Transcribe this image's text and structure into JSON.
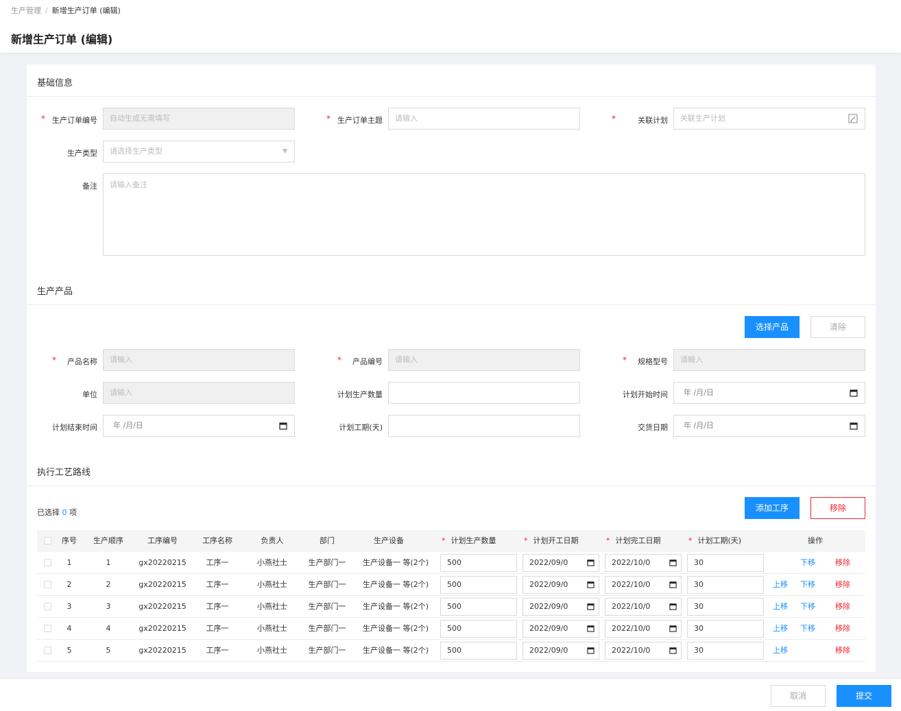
{
  "breadcrumb": {
    "parent": "生产管理",
    "separator": "/",
    "current": "新增生产订单 (编辑)"
  },
  "page_title": "新增生产订单 (编辑)",
  "basic": {
    "title": "基础信息",
    "order_no": {
      "label": "生产订单编号",
      "placeholder": "自动生成无需填写"
    },
    "order_subject": {
      "label": "生产订单主题",
      "placeholder": "请输入"
    },
    "related_plan": {
      "label": "关联计划",
      "placeholder": "关联生产计划",
      "icon": "edit-icon"
    },
    "prod_type": {
      "label": "生产类型",
      "placeholder": "请选择生产类型"
    },
    "remark": {
      "label": "备注",
      "placeholder": "请输入备注"
    }
  },
  "product": {
    "title": "生产产品",
    "select_btn": "选择产品",
    "clear_btn": "清除",
    "name": {
      "label": "产品名称",
      "placeholder": "请输入"
    },
    "code": {
      "label": "产品编号",
      "placeholder": "请输入"
    },
    "spec": {
      "label": "规格型号",
      "placeholder": "请输入"
    },
    "unit": {
      "label": "单位",
      "placeholder": "请输入"
    },
    "plan_qty": {
      "label": "计划生产数量",
      "value": ""
    },
    "plan_start": {
      "label": "计划开始时间",
      "value": "年 /月/日"
    },
    "plan_end": {
      "label": "计划结束时间",
      "value": "年 /月/日"
    },
    "plan_days": {
      "label": "计划工期(天)",
      "value": ""
    },
    "delivery": {
      "label": "交货日期",
      "value": "年 /月/日"
    }
  },
  "route": {
    "title": "执行工艺路线",
    "selected_prefix": "已选择",
    "selected_count": "0",
    "selected_suffix": "项",
    "add_btn": "添加工序",
    "remove_btn": "移除",
    "columns": [
      "序号",
      "生产顺序",
      "工序编号",
      "工序名称",
      "负责人",
      "部门",
      "生产设备",
      "计划生产数量",
      "计划开工日期",
      "计划完工日期",
      "计划工期(天)",
      "操作"
    ],
    "rows": [
      {
        "no": "1",
        "order": "1",
        "code": "gx20220215",
        "name": "工序一",
        "owner": "小燕社士",
        "dept": "生产部门一",
        "equip": "生产设备一 等(2个)",
        "qty": "500",
        "start": "2022/09/0",
        "end": "2022/10/0",
        "days": "30",
        "up": "",
        "down": "下移",
        "remove": "移除"
      },
      {
        "no": "2",
        "order": "2",
        "code": "gx20220215",
        "name": "工序一",
        "owner": "小燕社士",
        "dept": "生产部门一",
        "equip": "生产设备一 等(2个)",
        "qty": "500",
        "start": "2022/09/0",
        "end": "2022/10/0",
        "days": "30",
        "up": "上移",
        "down": "下移",
        "remove": "移除"
      },
      {
        "no": "3",
        "order": "3",
        "code": "gx20220215",
        "name": "工序一",
        "owner": "小燕社士",
        "dept": "生产部门一",
        "equip": "生产设备一 等(2个)",
        "qty": "500",
        "start": "2022/09/0",
        "end": "2022/10/0",
        "days": "30",
        "up": "上移",
        "down": "下移",
        "remove": "移除"
      },
      {
        "no": "4",
        "order": "4",
        "code": "gx20220215",
        "name": "工序一",
        "owner": "小燕社士",
        "dept": "生产部门一",
        "equip": "生产设备一 等(2个)",
        "qty": "500",
        "start": "2022/09/0",
        "end": "2022/10/0",
        "days": "30",
        "up": "上移",
        "down": "下移",
        "remove": "移除"
      },
      {
        "no": "5",
        "order": "5",
        "code": "gx20220215",
        "name": "工序一",
        "owner": "小燕社士",
        "dept": "生产部门一",
        "equip": "生产设备一 等(2个)",
        "qty": "500",
        "start": "2022/09/0",
        "end": "2022/10/0",
        "days": "30",
        "up": "上移",
        "down": "",
        "remove": "移除"
      }
    ]
  },
  "footer": {
    "cancel": "取消",
    "submit": "提交"
  },
  "colors": {
    "primary": "#1890ff",
    "danger": "#f5222d"
  }
}
